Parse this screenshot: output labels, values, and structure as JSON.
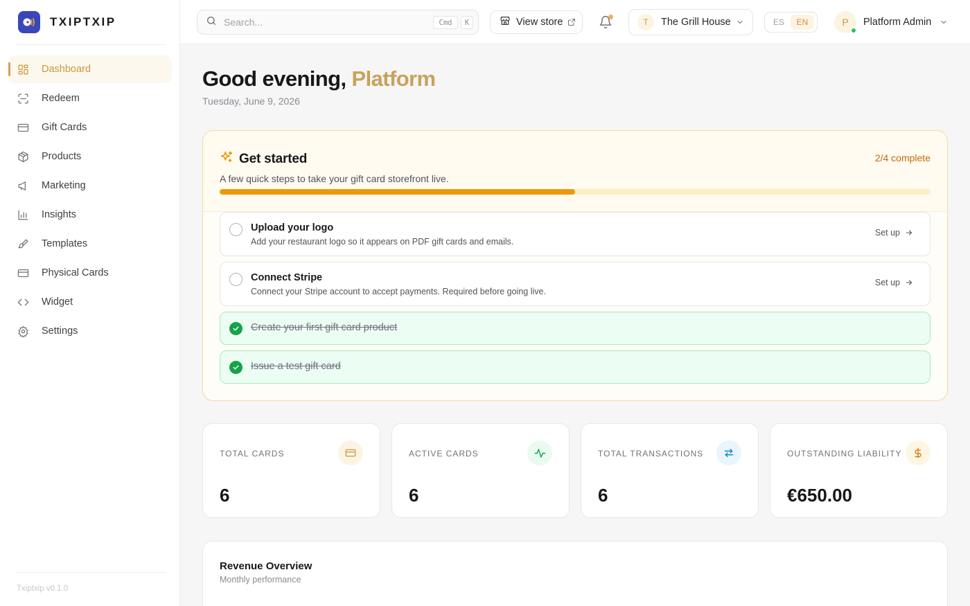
{
  "brand": {
    "name": "TXIPTXIP",
    "accent": "#3b47b8"
  },
  "sidebar": {
    "items": [
      {
        "label": "Dashboard",
        "icon": "dashboard-icon",
        "active": true
      },
      {
        "label": "Redeem",
        "icon": "scan-icon"
      },
      {
        "label": "Gift Cards",
        "icon": "credit-card-icon"
      },
      {
        "label": "Products",
        "icon": "package-icon"
      },
      {
        "label": "Marketing",
        "icon": "megaphone-icon"
      },
      {
        "label": "Insights",
        "icon": "bar-chart-icon"
      },
      {
        "label": "Templates",
        "icon": "paintbrush-icon"
      },
      {
        "label": "Physical Cards",
        "icon": "credit-card-icon"
      },
      {
        "label": "Widget",
        "icon": "code-icon"
      },
      {
        "label": "Settings",
        "icon": "gear-icon"
      }
    ],
    "version": "Txiptxip v0.1.0"
  },
  "topbar": {
    "search_placeholder": "Search...",
    "shortcut": [
      "Cmd",
      "K"
    ],
    "view_store": "View store",
    "venue": {
      "initial": "T",
      "name": "The Grill House"
    },
    "languages": [
      "ES",
      "EN"
    ],
    "active_language": "EN",
    "user": {
      "initial": "P",
      "name": "Platform Admin"
    }
  },
  "greeting": {
    "prefix": "Good evening,",
    "name": "Platform",
    "date": "Tuesday, June 9, 2026"
  },
  "get_started": {
    "title": "Get started",
    "subtitle": "A few quick steps to take your gift card storefront live.",
    "progress_text": "2/4 complete",
    "progress_fraction": 0.5,
    "steps": [
      {
        "title": "Upload your logo",
        "desc": "Add your restaurant logo so it appears on PDF gift cards and emails.",
        "action": "Set up",
        "done": false
      },
      {
        "title": "Connect Stripe",
        "desc": "Connect your Stripe account to accept payments. Required before going live.",
        "action": "Set up",
        "done": false
      },
      {
        "title": "Create your first gift card product",
        "done": true
      },
      {
        "title": "Issue a test gift card",
        "done": true
      }
    ]
  },
  "stats": [
    {
      "label": "TOTAL CARDS",
      "value": "6",
      "icon": "credit-card-icon",
      "color": "#c9963f"
    },
    {
      "label": "ACTIVE CARDS",
      "value": "6",
      "icon": "activity-icon",
      "color": "#16a34a"
    },
    {
      "label": "TOTAL TRANSACTIONS",
      "value": "6",
      "icon": "arrows-swap-icon",
      "color": "#0284c7"
    },
    {
      "label": "OUTSTANDING LIABILITY",
      "value": "€650.00",
      "icon": "dollar-icon",
      "color": "#d97706"
    }
  ],
  "revenue": {
    "title": "Revenue Overview",
    "subtitle": "Monthly performance"
  }
}
